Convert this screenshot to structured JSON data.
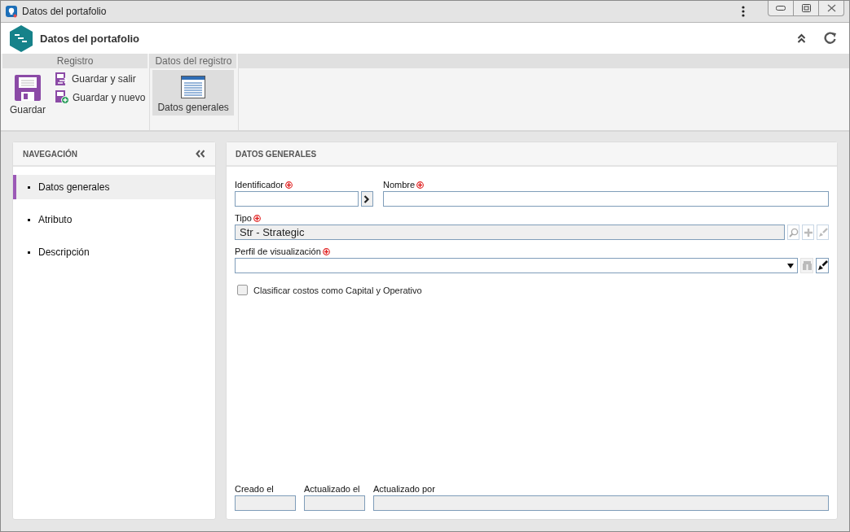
{
  "window": {
    "title": "Datos del portafolio"
  },
  "header": {
    "title": "Datos del portafolio"
  },
  "ribbon": {
    "groups": [
      {
        "title": "Registro",
        "buttons": [
          {
            "kind": "large",
            "label": "Guardar",
            "selected": false
          },
          {
            "kind": "small",
            "label": "Guardar y salir",
            "selected": false
          },
          {
            "kind": "small",
            "label": "Guardar y nuevo",
            "selected": false
          }
        ]
      },
      {
        "title": "Datos del registro",
        "buttons": [
          {
            "kind": "large",
            "label": "Datos generales",
            "selected": true
          }
        ]
      }
    ]
  },
  "nav": {
    "title": "NAVEGACIÓN",
    "items": [
      {
        "label": "Datos generales",
        "selected": true
      },
      {
        "label": "Atributo",
        "selected": false
      },
      {
        "label": "Descripción",
        "selected": false
      }
    ]
  },
  "form": {
    "title": "DATOS GENERALES",
    "rows": [
      [
        {
          "kind": "text-go",
          "label": "Identificador",
          "required": true,
          "disabled": false
        },
        {
          "kind": "text",
          "label": "Nombre",
          "required": true,
          "disabled": false
        }
      ],
      [
        {
          "kind": "lookup",
          "label": "Tipo",
          "required": true,
          "disabled": true,
          "value": "Str - Strategic"
        }
      ],
      [
        {
          "kind": "select",
          "label": "Perfil de visualización",
          "required": true,
          "disabled": false
        }
      ]
    ],
    "checkbox": {
      "label": "Clasificar costos como Capital y Operativo",
      "checked": false
    },
    "audit_fields": [
      {
        "label": "Creado el",
        "disabled": true
      },
      {
        "label": "Actualizado el",
        "disabled": true
      },
      {
        "label": "Actualizado por",
        "disabled": true
      }
    ]
  }
}
